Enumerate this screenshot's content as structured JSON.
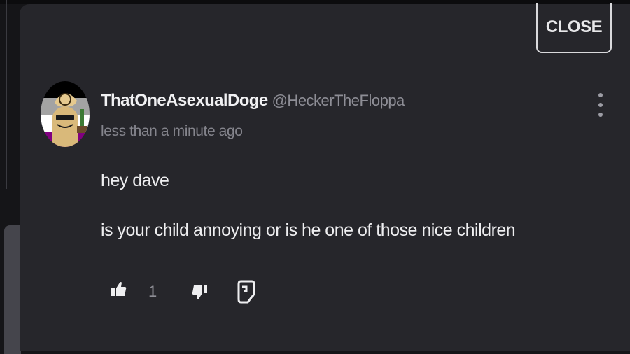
{
  "modal": {
    "close_label": "CLOSE"
  },
  "comment": {
    "author_name": "ThatOneAsexualDoge",
    "author_handle": "@HeckerTheFloppa",
    "timestamp": "less than a minute ago",
    "body_lines": [
      "hey dave",
      "is your child annoying or is he one of those nice children"
    ],
    "like_count": "1"
  },
  "icons": {
    "like": "thumbs-up-icon",
    "dislike": "thumbs-down-icon",
    "report": "report-flag-icon",
    "menu": "more-vertical-icon"
  },
  "colors": {
    "modal_bg": "#26262b",
    "text_primary": "#eeeef0",
    "text_muted": "#8e8e96",
    "avatar_flag": [
      "#000000",
      "#a3a3a3",
      "#ffffff",
      "#800080"
    ]
  }
}
